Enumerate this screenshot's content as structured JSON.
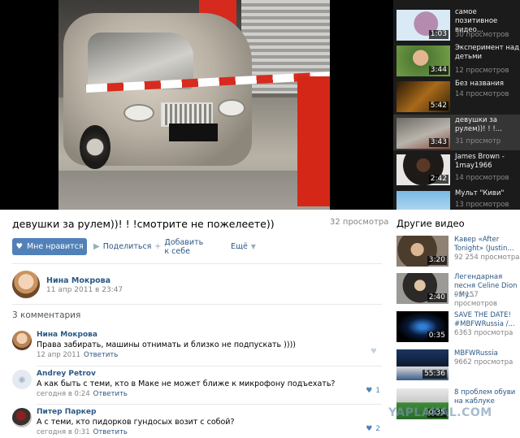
{
  "video": {
    "title": "девушки за рулем))! ! !смотрите не пожелеете))",
    "views": "32 просмотра"
  },
  "actions": {
    "like": "Мне нравится",
    "share": "Поделиться",
    "add": "Добавить к себе",
    "more": "Ещё"
  },
  "author": {
    "name": "Нина Мокрова",
    "date": "11 апр 2011 в 23:47"
  },
  "comments_count": "3 комментария",
  "comments": [
    {
      "name": "Нина Мокрова",
      "text": "Права забирать, машины отнимать и близко не подпускать ))))",
      "date": "12 апр 2011",
      "reply": "Ответить",
      "likes": ""
    },
    {
      "name": "Andrey Petrov",
      "text": "А как быть с теми, кто в Маке не может ближе к микрофону подъехать?",
      "date": "сегодня в 0:24",
      "reply": "Ответить",
      "likes": "1"
    },
    {
      "name": "Питер Паркер",
      "text": "А с теми, кто пидорков гундосых возит с собой?",
      "date": "сегодня в 0:31",
      "reply": "Ответить",
      "likes": "2"
    }
  ],
  "playlist": [
    {
      "title": "самое позитивное видео...",
      "views": "30 просмотров",
      "duration": "1:03"
    },
    {
      "title": "Эксперимент над детьми",
      "views": "12 просмотров",
      "duration": "3:44"
    },
    {
      "title": "Без названия",
      "views": "14 просмотров",
      "duration": "5:42"
    },
    {
      "title": "девушки за рулем))! ! !...",
      "views": "31 просмотр",
      "duration": "3:43"
    },
    {
      "title": "James Brown - 1mау1966",
      "views": "14 просмотров",
      "duration": "2:42"
    },
    {
      "title": "Мульт \"Киви\"",
      "views": "13 просмотров",
      "duration": ""
    }
  ],
  "other_videos_title": "Другие видео",
  "other_videos": [
    {
      "title": "Кавер «After Tonight» (Justin...",
      "views": "92 254 просмотра",
      "duration": "3:20"
    },
    {
      "title": "Легендарная песня Celine Dion - My...",
      "views": "95 157 просмотров",
      "duration": "2:40"
    },
    {
      "title": "SAVE THE DATE! #MBFWRussia /...",
      "views": "6363 просмотра",
      "duration": "0:35"
    },
    {
      "title": "MBFWRussia",
      "views": "9662 просмотра",
      "duration": "55:36"
    },
    {
      "title": "8 проблем обуви на каблуке",
      "views": "",
      "duration": "0:35"
    }
  ],
  "watermark": "YAPLAKAL.COM"
}
